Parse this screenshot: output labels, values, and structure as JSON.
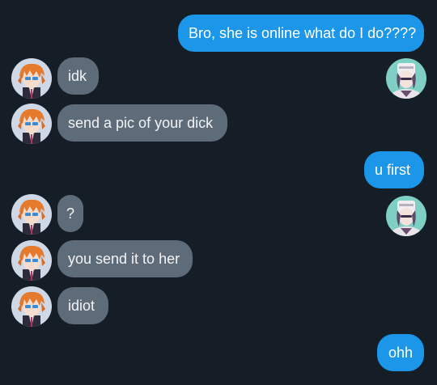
{
  "messages": [
    {
      "side": "out",
      "text": "Bro, she is online what do I do????"
    },
    {
      "side": "in",
      "text": "idk"
    },
    {
      "side": "in",
      "text": "send a pic of your dick"
    },
    {
      "side": "out",
      "text": "u first"
    },
    {
      "side": "in",
      "text": "?"
    },
    {
      "side": "in",
      "text": "you send it to her"
    },
    {
      "side": "in",
      "text": "idiot"
    },
    {
      "side": "out",
      "text": "ohh"
    }
  ],
  "avatars": {
    "friend": "friend-avatar",
    "me": "own-avatar"
  },
  "colors": {
    "background": "#151d27",
    "incoming_bubble": "#5e6b78",
    "outgoing_bubble": "#1c96e8"
  }
}
